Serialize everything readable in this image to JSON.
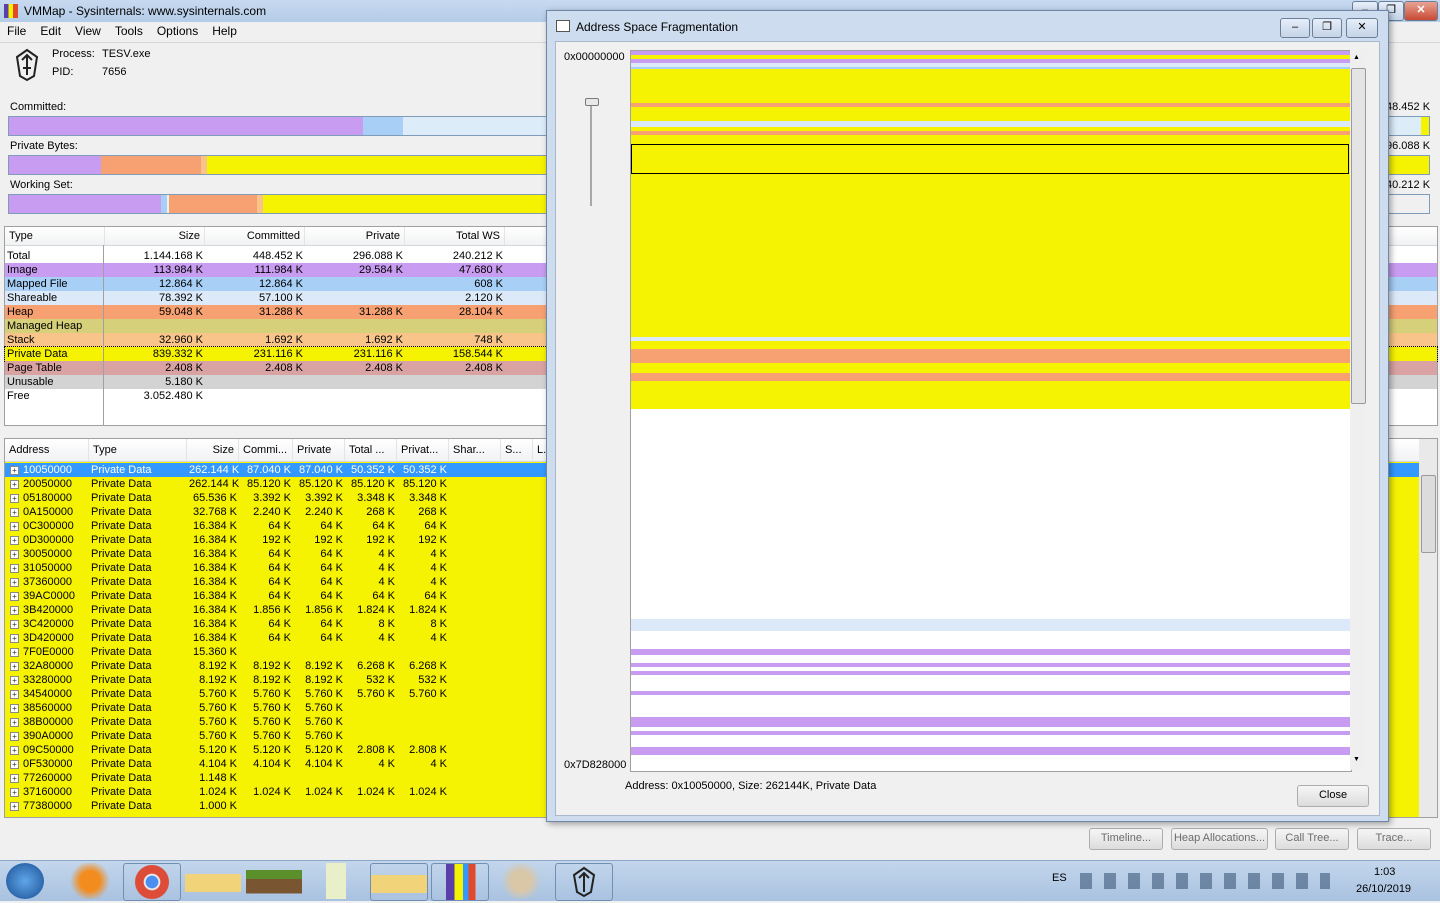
{
  "window": {
    "title": "VMMap - Sysinternals: www.sysinternals.com"
  },
  "menu": [
    "File",
    "Edit",
    "View",
    "Tools",
    "Options",
    "Help"
  ],
  "process": {
    "process_label": "Process:",
    "process_value": "TESV.exe",
    "pid_label": "PID:",
    "pid_value": "7656"
  },
  "meters": {
    "committed_label": "Committed:",
    "private_label": "Private Bytes:",
    "ws_label": "Working Set:",
    "committed_right": "48.452 K",
    "private_right": "96.088 K",
    "ws_right": "40.212 K"
  },
  "colors": {
    "image": "#c89cf0",
    "mapped": "#a8d0f7",
    "shareable": "#dce9f8",
    "heap": "#f7a172",
    "managed": "#d7d07a",
    "stack": "#f8c489",
    "private": "#f5f202",
    "pagetable": "#d9a3a3",
    "unusable": "#d3d3d3",
    "free": "#ffffff",
    "select": "#3399ff"
  },
  "summary": {
    "headers": [
      "Type",
      "Size",
      "Committed",
      "Private",
      "Total WS"
    ],
    "rows": [
      {
        "c": "free",
        "t": "Total",
        "s": "1.144.168 K",
        "cm": "448.452 K",
        "p": "296.088 K",
        "ws": "240.212 K"
      },
      {
        "c": "image",
        "t": "Image",
        "s": "113.984 K",
        "cm": "111.984 K",
        "p": "29.584 K",
        "ws": "47.680 K"
      },
      {
        "c": "mapped",
        "t": "Mapped File",
        "s": "12.864 K",
        "cm": "12.864 K",
        "p": "",
        "ws": "608 K"
      },
      {
        "c": "shareable",
        "t": "Shareable",
        "s": "78.392 K",
        "cm": "57.100 K",
        "p": "",
        "ws": "2.120 K"
      },
      {
        "c": "heap",
        "t": "Heap",
        "s": "59.048 K",
        "cm": "31.288 K",
        "p": "31.288 K",
        "ws": "28.104 K"
      },
      {
        "c": "managed",
        "t": "Managed Heap",
        "s": "",
        "cm": "",
        "p": "",
        "ws": ""
      },
      {
        "c": "stack",
        "t": "Stack",
        "s": "32.960 K",
        "cm": "1.692 K",
        "p": "1.692 K",
        "ws": "748 K"
      },
      {
        "c": "private",
        "t": "Private Data",
        "s": "839.332 K",
        "cm": "231.116 K",
        "p": "231.116 K",
        "ws": "158.544 K"
      },
      {
        "c": "pagetable",
        "t": "Page Table",
        "s": "2.408 K",
        "cm": "2.408 K",
        "p": "2.408 K",
        "ws": "2.408 K"
      },
      {
        "c": "unusable",
        "t": "Unusable",
        "s": "5.180 K",
        "cm": "",
        "p": "",
        "ws": ""
      },
      {
        "c": "free",
        "t": "Free",
        "s": "3.052.480 K",
        "cm": "",
        "p": "",
        "ws": ""
      }
    ]
  },
  "detail": {
    "headers": [
      "Address",
      "Type",
      "Size",
      "Commi...",
      "Private",
      "Total ...",
      "Privat...",
      "Shar...",
      "S...",
      "L..."
    ],
    "rows": [
      [
        "10050000",
        "Private Data",
        "262.144 K",
        "87.040 K",
        "87.040 K",
        "50.352 K",
        "50.352 K"
      ],
      [
        "20050000",
        "Private Data",
        "262.144 K",
        "85.120 K",
        "85.120 K",
        "85.120 K",
        "85.120 K"
      ],
      [
        "05180000",
        "Private Data",
        "65.536 K",
        "3.392 K",
        "3.392 K",
        "3.348 K",
        "3.348 K"
      ],
      [
        "0A150000",
        "Private Data",
        "32.768 K",
        "2.240 K",
        "2.240 K",
        "268 K",
        "268 K"
      ],
      [
        "0C300000",
        "Private Data",
        "16.384 K",
        "64 K",
        "64 K",
        "64 K",
        "64 K"
      ],
      [
        "0D300000",
        "Private Data",
        "16.384 K",
        "192 K",
        "192 K",
        "192 K",
        "192 K"
      ],
      [
        "30050000",
        "Private Data",
        "16.384 K",
        "64 K",
        "64 K",
        "4 K",
        "4 K"
      ],
      [
        "31050000",
        "Private Data",
        "16.384 K",
        "64 K",
        "64 K",
        "4 K",
        "4 K"
      ],
      [
        "37360000",
        "Private Data",
        "16.384 K",
        "64 K",
        "64 K",
        "4 K",
        "4 K"
      ],
      [
        "39AC0000",
        "Private Data",
        "16.384 K",
        "64 K",
        "64 K",
        "64 K",
        "64 K"
      ],
      [
        "3B420000",
        "Private Data",
        "16.384 K",
        "1.856 K",
        "1.856 K",
        "1.824 K",
        "1.824 K"
      ],
      [
        "3C420000",
        "Private Data",
        "16.384 K",
        "64 K",
        "64 K",
        "8 K",
        "8 K"
      ],
      [
        "3D420000",
        "Private Data",
        "16.384 K",
        "64 K",
        "64 K",
        "4 K",
        "4 K"
      ],
      [
        "7F0E0000",
        "Private Data",
        "15.360 K",
        "",
        "",
        "",
        ""
      ],
      [
        "32A80000",
        "Private Data",
        "8.192 K",
        "8.192 K",
        "8.192 K",
        "6.268 K",
        "6.268 K"
      ],
      [
        "33280000",
        "Private Data",
        "8.192 K",
        "8.192 K",
        "8.192 K",
        "532 K",
        "532 K"
      ],
      [
        "34540000",
        "Private Data",
        "5.760 K",
        "5.760 K",
        "5.760 K",
        "5.760 K",
        "5.760 K"
      ],
      [
        "38560000",
        "Private Data",
        "5.760 K",
        "5.760 K",
        "5.760 K",
        "",
        ""
      ],
      [
        "38B00000",
        "Private Data",
        "5.760 K",
        "5.760 K",
        "5.760 K",
        "",
        ""
      ],
      [
        "390A0000",
        "Private Data",
        "5.760 K",
        "5.760 K",
        "5.760 K",
        "",
        ""
      ],
      [
        "09C50000",
        "Private Data",
        "5.120 K",
        "5.120 K",
        "5.120 K",
        "2.808 K",
        "2.808 K"
      ],
      [
        "0F530000",
        "Private Data",
        "4.104 K",
        "4.104 K",
        "4.104 K",
        "4 K",
        "4 K"
      ],
      [
        "77260000",
        "Private Data",
        "1.148 K",
        "",
        "",
        "",
        ""
      ],
      [
        "37160000",
        "Private Data",
        "1.024 K",
        "1.024 K",
        "1.024 K",
        "1.024 K",
        "1.024 K"
      ],
      [
        "77380000",
        "Private Data",
        "1.000 K",
        "",
        "",
        "",
        ""
      ]
    ]
  },
  "buttons": {
    "timeline": "Timeline...",
    "heap": "Heap Allocations...",
    "calltree": "Call Tree...",
    "trace": "Trace..."
  },
  "frag": {
    "title": "Address Space Fragmentation",
    "addr_top": "0x00000000",
    "addr_bottom": "0x7D828000",
    "status": "Address: 0x10050000, Size: 262144K, Private Data",
    "close": "Close"
  },
  "taskbar": {
    "lang": "ES",
    "time": "1:03",
    "date": "26/10/2019"
  }
}
